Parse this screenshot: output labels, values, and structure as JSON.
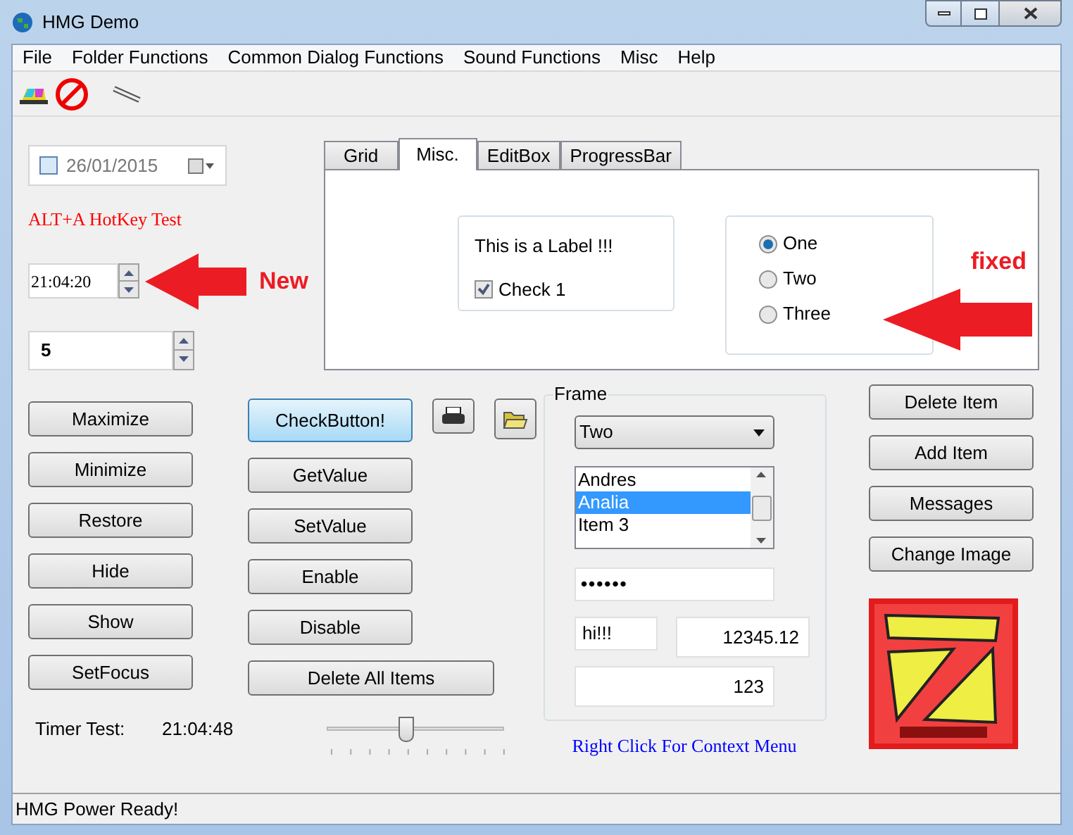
{
  "window": {
    "title": "HMG Demo"
  },
  "menu": [
    {
      "label": "File"
    },
    {
      "label": "Folder Functions"
    },
    {
      "label": "Common Dialog Functions"
    },
    {
      "label": "Sound Functions"
    },
    {
      "label": "Misc"
    },
    {
      "label": "Help"
    }
  ],
  "date_picker": {
    "value": "26/01/2015",
    "checked": false
  },
  "hotkey_label": "ALT+A HotKey Test",
  "time_spinner": {
    "value": "21:04:20"
  },
  "number_spinner": {
    "value": "5"
  },
  "annotations": [
    {
      "text": "New"
    },
    {
      "text": "fixed"
    }
  ],
  "tabs": [
    {
      "label": "Grid",
      "selected": false
    },
    {
      "label": "Misc.",
      "selected": true
    },
    {
      "label": "EditBox",
      "selected": false
    },
    {
      "label": "ProgressBar",
      "selected": false
    }
  ],
  "misc_panel": {
    "label": "This is a Label !!!",
    "checkbox": {
      "label": "Check 1",
      "checked": true
    },
    "radios": [
      {
        "label": "One",
        "selected": true
      },
      {
        "label": "Two",
        "selected": false
      },
      {
        "label": "Three",
        "selected": false
      }
    ]
  },
  "left_buttons": [
    {
      "label": "Maximize"
    },
    {
      "label": "Minimize"
    },
    {
      "label": "Restore"
    },
    {
      "label": "Hide"
    },
    {
      "label": "Show"
    },
    {
      "label": "SetFocus"
    }
  ],
  "middle_buttons": [
    {
      "label": "CheckButton!",
      "focused": true
    },
    {
      "label": "GetValue",
      "focused": false
    },
    {
      "label": "SetValue",
      "focused": false
    },
    {
      "label": "Enable",
      "focused": false
    },
    {
      "label": "Disable",
      "focused": false
    },
    {
      "label": "Delete All Items",
      "focused": false
    }
  ],
  "timer": {
    "label": "Timer Test:",
    "value": "21:04:48"
  },
  "slider": {
    "level": 0.45
  },
  "frame": {
    "title": "Frame",
    "combo": {
      "value": "Two"
    },
    "list": [
      {
        "label": "Andres",
        "selected": false
      },
      {
        "label": "Analia",
        "selected": true
      },
      {
        "label": "Item 3",
        "selected": false
      }
    ],
    "password": "••••••",
    "text": "hi!!!",
    "number": "12345.12",
    "integer": "123"
  },
  "context_hint": "Right Click For Context Menu",
  "right_buttons": [
    {
      "label": "Delete Item"
    },
    {
      "label": "Add Item"
    },
    {
      "label": "Messages"
    },
    {
      "label": "Change Image"
    }
  ],
  "status_bar": "HMG Power Ready!"
}
